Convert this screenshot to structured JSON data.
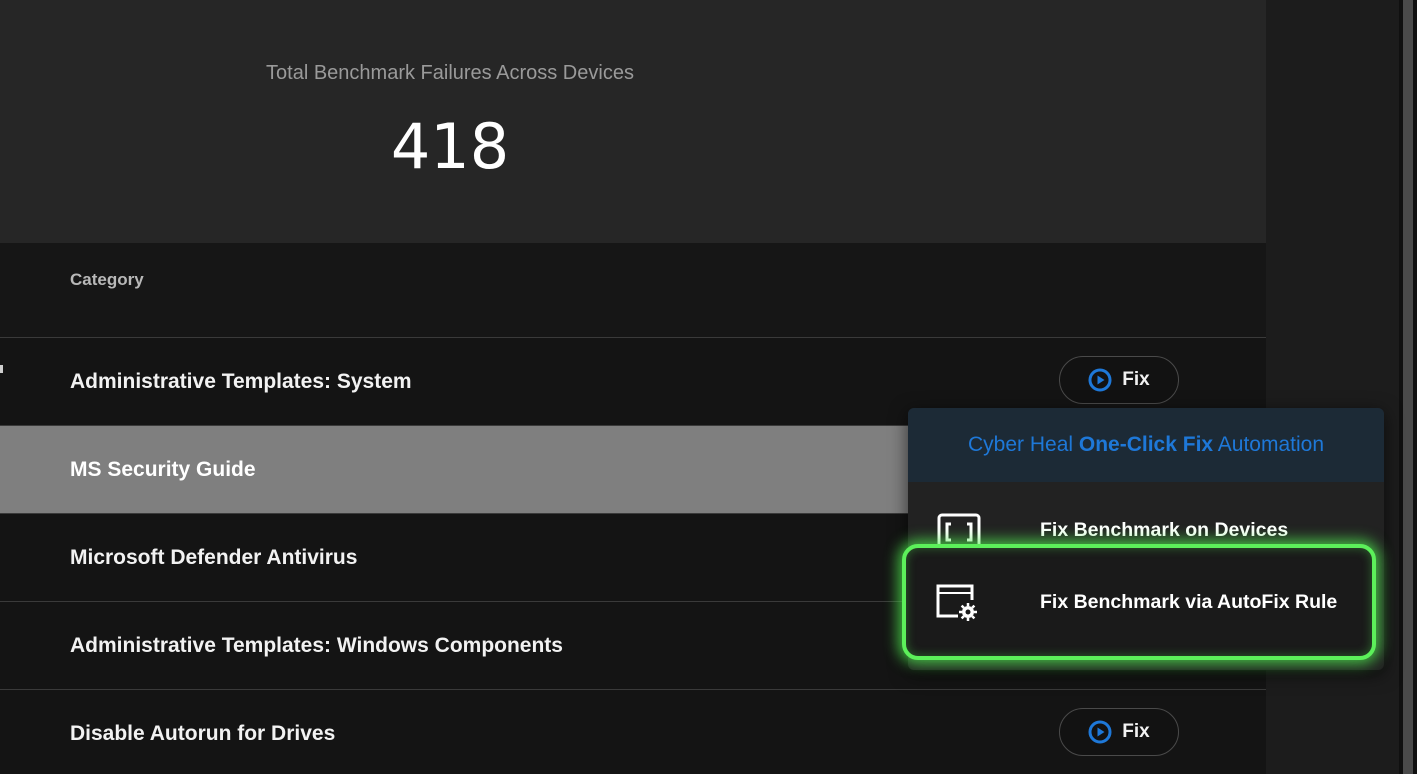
{
  "summary": {
    "title": "Total Benchmark Failures Across Devices",
    "value": "418"
  },
  "table": {
    "column_header": "Category",
    "rows": [
      {
        "label": "Administrative Templates: System"
      },
      {
        "label": "MS Security Guide"
      },
      {
        "label": "Microsoft Defender Antivirus"
      },
      {
        "label": "Administrative Templates: Windows Components"
      },
      {
        "label": "Disable Autorun for Drives"
      }
    ],
    "fix_label": "Fix",
    "selected_row": 1
  },
  "dropdown": {
    "header_prefix": "Cyber Heal ",
    "header_highlight": "One-Click Fix",
    "header_suffix": " Automation",
    "items": [
      {
        "label": "Fix Benchmark on Devices",
        "icon": "device-bracket-icon"
      },
      {
        "label": "Fix Benchmark via AutoFix Rule",
        "icon": "window-gear-icon"
      }
    ]
  },
  "colors": {
    "accent": "#1e78d8",
    "highlight_glow": "#5cf05a",
    "selected_row": "#7f7f7f"
  }
}
